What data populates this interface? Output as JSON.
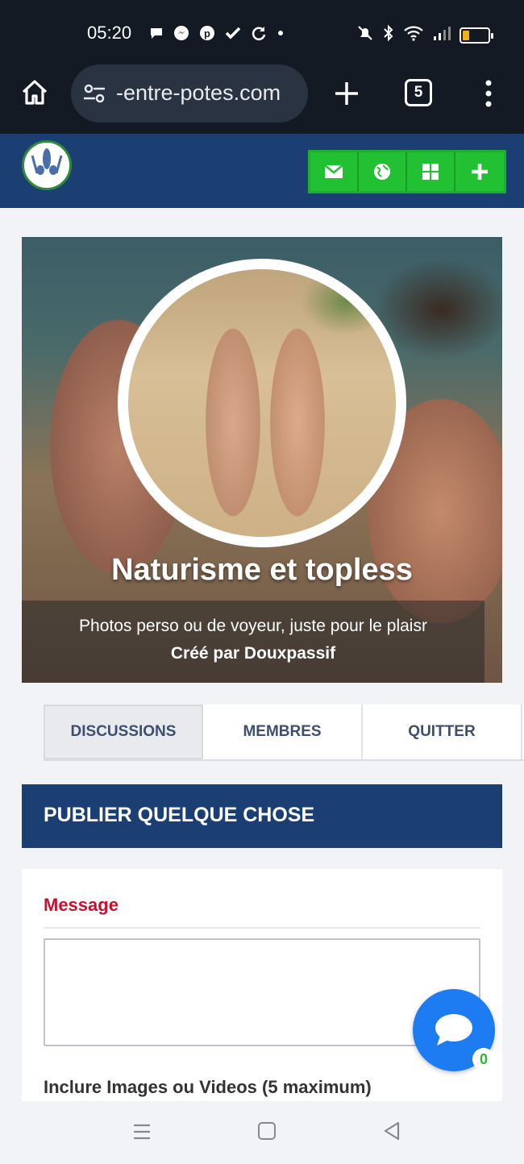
{
  "status_bar": {
    "time": "05:20",
    "left_icons": [
      "chat-bubble-icon",
      "messenger-icon",
      "pinterest-icon",
      "check-icon",
      "sync-icon",
      "dot-icon"
    ],
    "right_icons": [
      "mute-icon",
      "bluetooth-icon",
      "wifi-icon",
      "signal-icon",
      "battery-icon"
    ],
    "battery_level": 0.25
  },
  "browser": {
    "url": "-entre-potes.com",
    "tab_count": "5"
  },
  "site_header": {
    "buttons": [
      "mail-icon",
      "globe-icon",
      "grid-icon",
      "plus-icon"
    ]
  },
  "group": {
    "title": "Naturisme et topless",
    "subtitle": "Photos perso ou de voyeur, juste pour le plaisr",
    "creator": "Créé par Douxpassif"
  },
  "tabs": [
    {
      "label": "DISCUSSIONS",
      "active": true
    },
    {
      "label": "MEMBRES",
      "active": false
    },
    {
      "label": "QUITTER",
      "active": false
    }
  ],
  "publish": {
    "header": "PUBLIER QUELQUE CHOSE",
    "message_label": "Message",
    "message_value": "",
    "include_label": "Inclure Images ou Videos (5 maximum)"
  },
  "chat": {
    "unread_count": "0"
  },
  "colors": {
    "header_blue": "#1b3f73",
    "button_green": "#22c033",
    "label_red": "#c8102e",
    "chat_blue": "#1e7cf2"
  }
}
